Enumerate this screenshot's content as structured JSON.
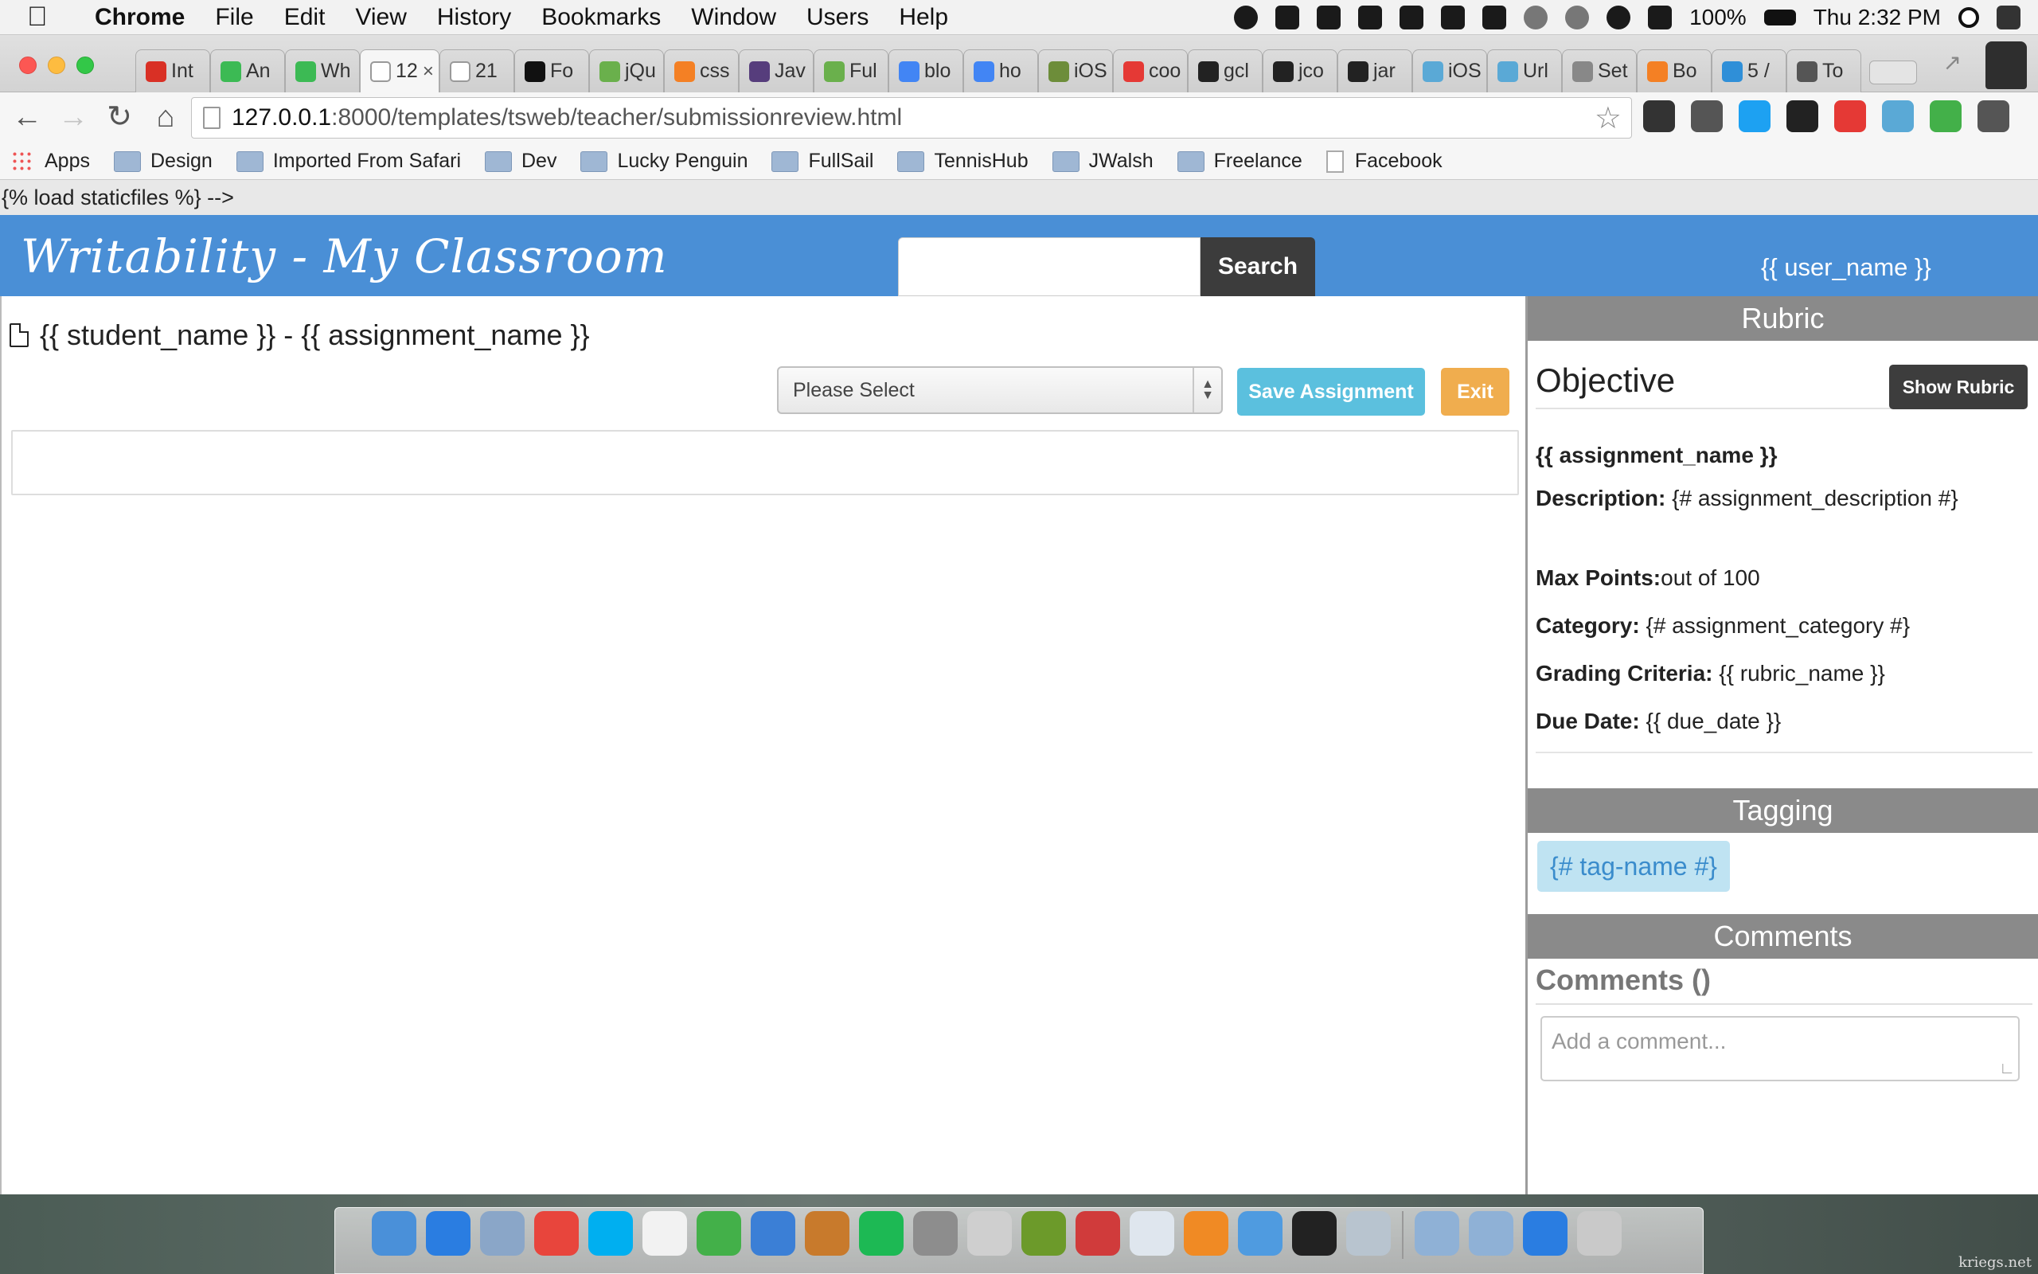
{
  "menubar": {
    "app_name": "Chrome",
    "items": [
      "File",
      "Edit",
      "View",
      "History",
      "Bookmarks",
      "Window",
      "Users",
      "Help"
    ],
    "battery": "100%",
    "clock": "Thu 2:32 PM"
  },
  "tabs": [
    {
      "label": "Int",
      "color": "#d93025",
      "icon": "gmail-icon"
    },
    {
      "label": "An",
      "color": "#3cba54",
      "icon": "angular-icon"
    },
    {
      "label": "Wh",
      "color": "#3cba54",
      "icon": "angular-icon"
    },
    {
      "label": "12",
      "color": "#ffffff",
      "icon": "page-icon",
      "active": true
    },
    {
      "label": "21",
      "color": "#ffffff",
      "icon": "page-icon"
    },
    {
      "label": "Fo",
      "color": "#111111",
      "icon": "flag-icon"
    },
    {
      "label": "jQu",
      "color": "#6ab04c",
      "icon": "q-icon"
    },
    {
      "label": "css",
      "color": "#f48024",
      "icon": "stackoverflow-icon"
    },
    {
      "label": "Jav",
      "color": "#563d7c",
      "icon": "bootstrap-icon"
    },
    {
      "label": "Ful",
      "color": "#6ab04c",
      "icon": "fullsail-icon"
    },
    {
      "label": "blo",
      "color": "#4285f4",
      "icon": "google-icon"
    },
    {
      "label": "ho",
      "color": "#4285f4",
      "icon": "google-icon"
    },
    {
      "label": "iOS",
      "color": "#6d8d3a",
      "icon": "ios-icon"
    },
    {
      "label": "coo",
      "color": "#e53935",
      "icon": "code-icon"
    },
    {
      "label": "gcl",
      "color": "#222222",
      "icon": "github-icon"
    },
    {
      "label": "jco",
      "color": "#222222",
      "icon": "github-icon"
    },
    {
      "label": "jar",
      "color": "#222222",
      "icon": "github-icon"
    },
    {
      "label": "iOS",
      "color": "#5aa9d6",
      "icon": "swift-icon"
    },
    {
      "label": "Url",
      "color": "#5aa9d6",
      "icon": "swift-icon"
    },
    {
      "label": "Set",
      "color": "#888888",
      "icon": "apple-icon"
    },
    {
      "label": "Bo",
      "color": "#f48024",
      "icon": "stackoverflow-icon"
    },
    {
      "label": "5 /",
      "color": "#2f8fd8",
      "icon": "m-icon"
    },
    {
      "label": "To",
      "color": "#555555",
      "icon": "grid-icon"
    }
  ],
  "tab_close": "×",
  "toolbar": {
    "url_host": "127.0.0.1",
    "url_rest": ":8000/templates/tsweb/teacher/submissionreview.html"
  },
  "extensions": [
    {
      "icon": "sync-icon",
      "color": "#333333"
    },
    {
      "icon": "evernote-icon",
      "color": "#555555"
    },
    {
      "icon": "check-icon",
      "color": "#1da1f2"
    },
    {
      "icon": "buffer-icon",
      "color": "#222222"
    },
    {
      "icon": "k-icon",
      "color": "#e53935"
    },
    {
      "icon": "wave-icon",
      "color": "#5aa9d6"
    },
    {
      "icon": "leaf-icon",
      "color": "#43b049"
    },
    {
      "icon": "menu-icon",
      "color": "#555555"
    }
  ],
  "bookmarks": [
    {
      "label": "Apps",
      "type": "apps"
    },
    {
      "label": "Design",
      "type": "folder"
    },
    {
      "label": "Imported From Safari",
      "type": "folder"
    },
    {
      "label": "Dev",
      "type": "folder"
    },
    {
      "label": "Lucky Penguin",
      "type": "folder"
    },
    {
      "label": "FullSail",
      "type": "folder"
    },
    {
      "label": "TennisHub",
      "type": "folder"
    },
    {
      "label": "JWalsh",
      "type": "folder"
    },
    {
      "label": "Freelance",
      "type": "folder"
    },
    {
      "label": "Facebook",
      "type": "page"
    }
  ],
  "page": {
    "template_text": "{% load staticfiles %} -->",
    "brand": "Writability - My Classroom",
    "search_button": "Search",
    "user_name": "{{ user_name }}",
    "submission_title": "{{ student_name }} - {{ assignment_name }}",
    "grade_select": "Please Select",
    "save_button": "Save Assignment",
    "exit_button": "Exit"
  },
  "sidebar": {
    "rubric_heading": "Rubric",
    "objective_title": "Objective",
    "show_rubric_button": "Show Rubric",
    "assignment_name": "{{ assignment_name }}",
    "description_label": "Description:",
    "description_value": " {# assignment_description #}",
    "max_points_label": "Max Points:",
    "max_points_value": "out of 100",
    "category_label": "Category:",
    "category_value": " {# assignment_category #}",
    "criteria_label": "Grading Criteria:",
    "criteria_value": " {{ rubric_name }}",
    "due_label": "Due Date:",
    "due_value": " {{ due_date }}",
    "tagging_heading": "Tagging",
    "tag": "{# tag-name #}",
    "comments_heading": "Comments",
    "comments_count": "Comments ()",
    "comment_placeholder": "Add a comment..."
  },
  "dock": [
    {
      "icon": "finder-icon",
      "color": "#4a90d9"
    },
    {
      "icon": "app-store-icon",
      "color": "#2a7de1"
    },
    {
      "icon": "preview-icon",
      "color": "#8aa6c8"
    },
    {
      "icon": "chrome-icon",
      "color": "#e8453c"
    },
    {
      "icon": "skype-icon",
      "color": "#00aff0"
    },
    {
      "icon": "calendar-icon",
      "color": "#f2f2f2"
    },
    {
      "icon": "evernote-icon",
      "color": "#43b049"
    },
    {
      "icon": "xcode-icon",
      "color": "#3b7fd6"
    },
    {
      "icon": "cocoapods-icon",
      "color": "#c87a2c"
    },
    {
      "icon": "spotify-icon",
      "color": "#1db954"
    },
    {
      "icon": "system-preferences-icon",
      "color": "#8d8d8d"
    },
    {
      "icon": "sequel-pro-icon",
      "color": "#cfcfcf"
    },
    {
      "icon": "brackets-icon",
      "color": "#6c9a2a"
    },
    {
      "icon": "photo-booth-icon",
      "color": "#d03b3b"
    },
    {
      "icon": "safari-icon",
      "color": "#dfe6ee"
    },
    {
      "icon": "ibooks-icon",
      "color": "#f08a24"
    },
    {
      "icon": "sketch-icon",
      "color": "#4f9be0"
    },
    {
      "icon": "terminal-icon",
      "color": "#222222"
    },
    {
      "icon": "photos-icon",
      "color": "#b8c4cf"
    },
    {
      "icon": "applications-folder-icon",
      "color": "#8fb1d6"
    },
    {
      "icon": "downloads-folder-icon",
      "color": "#8fb1d6"
    },
    {
      "icon": "app-store-folder-icon",
      "color": "#2a7de1"
    },
    {
      "icon": "trash-icon",
      "color": "#c9c9c9"
    }
  ],
  "watermark": "kriegs.net"
}
